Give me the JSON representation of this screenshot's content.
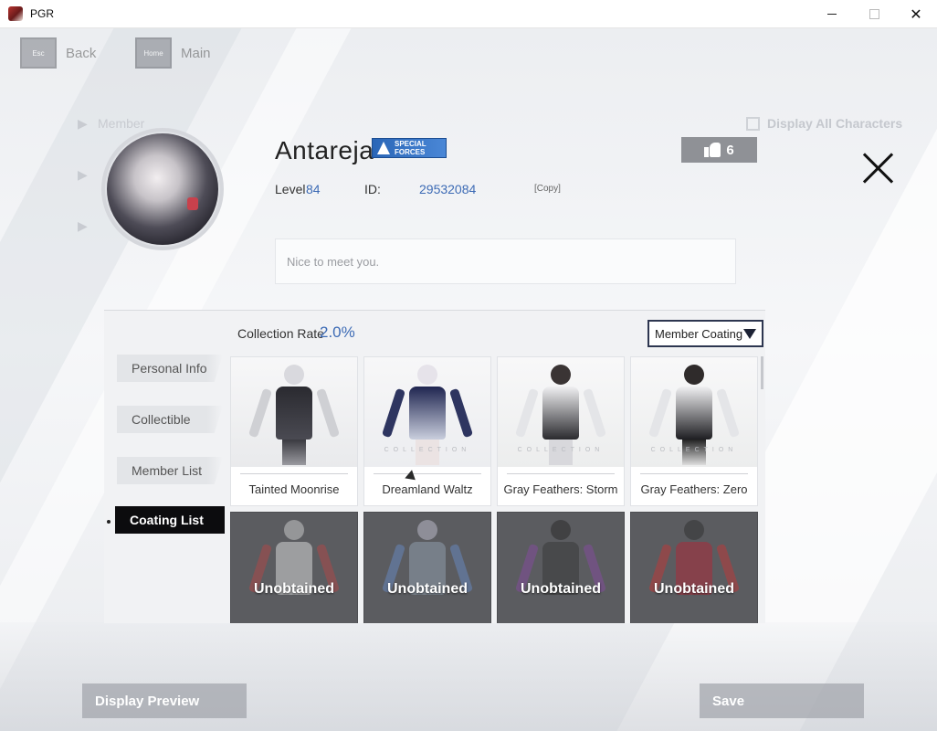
{
  "window": {
    "title": "PGR"
  },
  "nav": {
    "back_key": "Esc",
    "back_label": "Back",
    "home_key": "Home",
    "home_label": "Main"
  },
  "background": {
    "menu_item": "Member",
    "display_all": "Display All Characters"
  },
  "profile": {
    "username": "Antareja",
    "badge": "SPECIAL FORCES",
    "level_label": "Level",
    "level_value": "84",
    "id_label": "ID:",
    "id_value": "29532084",
    "copy_label": "[Copy]",
    "likes": "6",
    "message": "Nice to meet you."
  },
  "collection": {
    "rate_label": "Collection Rate",
    "rate_value": "2.0%",
    "filter_selected": "Member Coating"
  },
  "tabs": [
    {
      "label": "Personal Info"
    },
    {
      "label": "Collectible"
    },
    {
      "label": "Member List"
    },
    {
      "label": "Coating List"
    }
  ],
  "coatings": [
    {
      "name": "Tainted Moonrise",
      "obtained": true
    },
    {
      "name": "Dreamland Waltz",
      "obtained": true
    },
    {
      "name": "Gray Feathers: Storm",
      "obtained": true
    },
    {
      "name": "Gray Feathers: Zero",
      "obtained": true
    },
    {
      "name": "",
      "obtained": false,
      "overlay": "Unobtained"
    },
    {
      "name": "",
      "obtained": false,
      "overlay": "Unobtained"
    },
    {
      "name": "",
      "obtained": false,
      "overlay": "Unobtained"
    },
    {
      "name": "",
      "obtained": false,
      "overlay": "Unobtained"
    }
  ],
  "collection_watermark": "COLLECTION",
  "buttons": {
    "preview": "Display Preview",
    "save": "Save"
  },
  "colors": {
    "accent_blue": "#3d6bb5",
    "active_tab": "#0c0c0e",
    "locked_card": "#5b5c60"
  }
}
